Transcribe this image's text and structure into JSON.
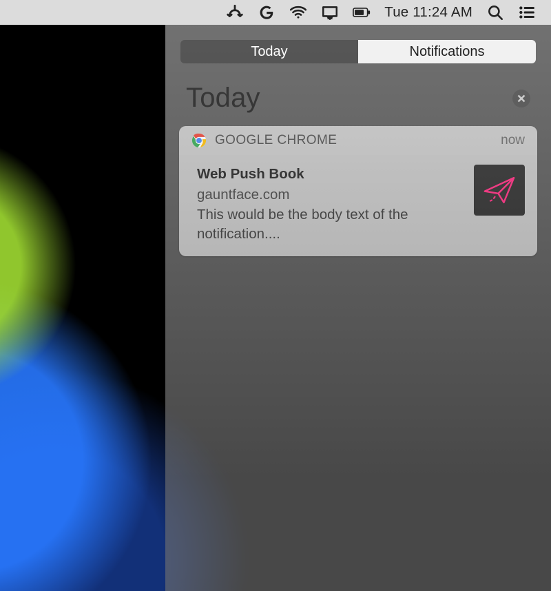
{
  "menubar": {
    "clock": "Tue 11:24 AM"
  },
  "nc": {
    "tabs": {
      "today": "Today",
      "notifications": "Notifications"
    },
    "sectionTitle": "Today"
  },
  "notification": {
    "app": "GOOGLE CHROME",
    "when": "now",
    "title": "Web Push Book",
    "site": "gauntface.com",
    "body": "This would be the body text of the notification...."
  }
}
